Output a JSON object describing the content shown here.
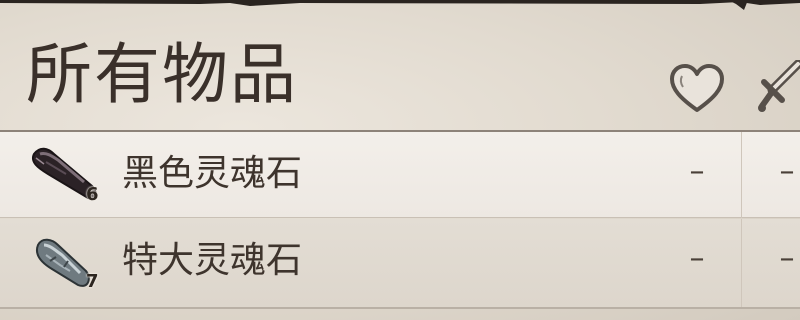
{
  "panel": {
    "title": "所有物品"
  },
  "header_icons": [
    {
      "name": "heart-icon"
    },
    {
      "name": "sword-icon"
    }
  ],
  "items": [
    {
      "name": "黑色灵魂石",
      "count": "6",
      "icon": "black-soul-stone-icon",
      "col_a": "–",
      "col_b": "–"
    },
    {
      "name": "特大灵魂石",
      "count": "7",
      "icon": "grand-soul-stone-icon",
      "col_a": "–",
      "col_b": "–"
    }
  ]
}
